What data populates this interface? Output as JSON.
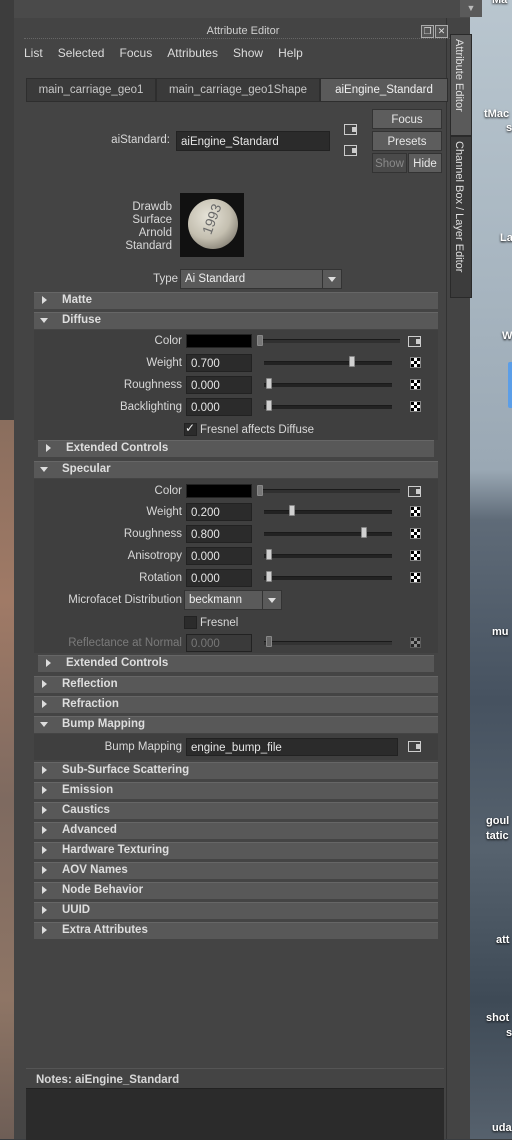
{
  "window": {
    "title": "Attribute Editor"
  },
  "menu": [
    "List",
    "Selected",
    "Focus",
    "Attributes",
    "Show",
    "Help"
  ],
  "tabs": [
    "main_carriage_geo1",
    "main_carriage_geo1Shape",
    "aiEngine_Standard"
  ],
  "side_tabs": [
    "Attribute Editor",
    "Channel Box / Layer Editor"
  ],
  "node": {
    "type_label": "aiStandard:",
    "name": "aiEngine_Standard",
    "focus_label": "Focus",
    "presets_label": "Presets",
    "show_label": "Show",
    "hide_label": "Hide",
    "swatch_caption": [
      "Drawdb",
      "Surface",
      "Arnold",
      "Standard"
    ],
    "swatch_number": "1993",
    "type_field_label": "Type",
    "type_value": "Ai Standard"
  },
  "sections": {
    "matte": "Matte",
    "diffuse": "Diffuse",
    "extended1": "Extended Controls",
    "specular": "Specular",
    "extended2": "Extended Controls",
    "reflection": "Reflection",
    "refraction": "Refraction",
    "bump": "Bump Mapping",
    "sss": "Sub-Surface Scattering",
    "emission": "Emission",
    "caustics": "Caustics",
    "advanced": "Advanced",
    "hwtex": "Hardware Texturing",
    "aov": "AOV Names",
    "nodebeh": "Node Behavior",
    "uuid": "UUID",
    "extra": "Extra Attributes"
  },
  "diffuse": {
    "color_label": "Color",
    "weight_label": "Weight",
    "weight": "0.700",
    "rough_label": "Roughness",
    "roughness": "0.000",
    "back_label": "Backlighting",
    "backlighting": "0.000",
    "fresnel_label": "Fresnel affects Diffuse"
  },
  "specular": {
    "color_label": "Color",
    "weight_label": "Weight",
    "weight": "0.200",
    "rough_label": "Roughness",
    "roughness": "0.800",
    "aniso_label": "Anisotropy",
    "anisotropy": "0.000",
    "rot_label": "Rotation",
    "rotation": "0.000",
    "micro_label": "Microfacet Distribution",
    "micro_value": "beckmann",
    "fresnel_label": "Fresnel",
    "refl_normal_label": "Reflectance at Normal",
    "refl_normal": "0.000"
  },
  "bump": {
    "label": "Bump Mapping",
    "value": "engine_bump_file"
  },
  "notes": {
    "label": "Notes:  aiEngine_Standard"
  },
  "desktop_labels": [
    "Ma",
    "tMac",
    "s",
    "La",
    "W",
    "mu",
    "goul",
    "tatic",
    "att",
    "shot",
    "s",
    "uda"
  ],
  "colors": {
    "panel": "#444444",
    "field": "#2b2b2b",
    "section": "#585858"
  }
}
